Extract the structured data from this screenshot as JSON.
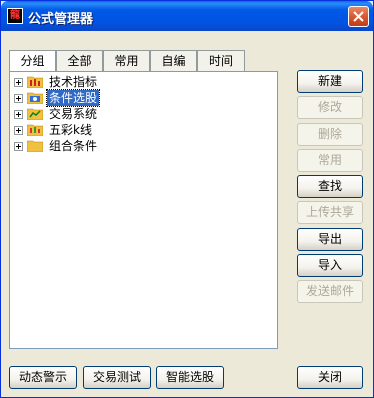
{
  "window": {
    "title": "公式管理器",
    "app_icon_char": "龍"
  },
  "tabs": [
    {
      "label": "分组",
      "active": true
    },
    {
      "label": "全部",
      "active": false
    },
    {
      "label": "常用",
      "active": false
    },
    {
      "label": "自编",
      "active": false
    },
    {
      "label": "时间",
      "active": false
    }
  ],
  "tree": [
    {
      "label": "技术指标",
      "icon": "indicator-folder-icon",
      "selected": false
    },
    {
      "label": "条件选股",
      "icon": "screener-folder-icon",
      "selected": true
    },
    {
      "label": "交易系统",
      "icon": "trading-folder-icon",
      "selected": false
    },
    {
      "label": "五彩k线",
      "icon": "candle-folder-icon",
      "selected": false
    },
    {
      "label": "组合条件",
      "icon": "folder-icon",
      "selected": false
    }
  ],
  "side_buttons": [
    {
      "label": "新建",
      "enabled": true
    },
    {
      "label": "修改",
      "enabled": false
    },
    {
      "label": "删除",
      "enabled": false
    },
    {
      "label": "常用",
      "enabled": false
    },
    {
      "label": "查找",
      "enabled": true
    },
    {
      "label": "上传共享",
      "enabled": false
    },
    {
      "label": "导出",
      "enabled": true
    },
    {
      "label": "导入",
      "enabled": true
    },
    {
      "label": "发送邮件",
      "enabled": false
    }
  ],
  "bottom_buttons": {
    "alert": "动态警示",
    "test": "交易测试",
    "smart": "智能选股",
    "close": "关闭"
  },
  "colors": {
    "title_bar": "#0054e3",
    "selection": "#316ac5",
    "dialog_bg": "#ece9d8"
  }
}
